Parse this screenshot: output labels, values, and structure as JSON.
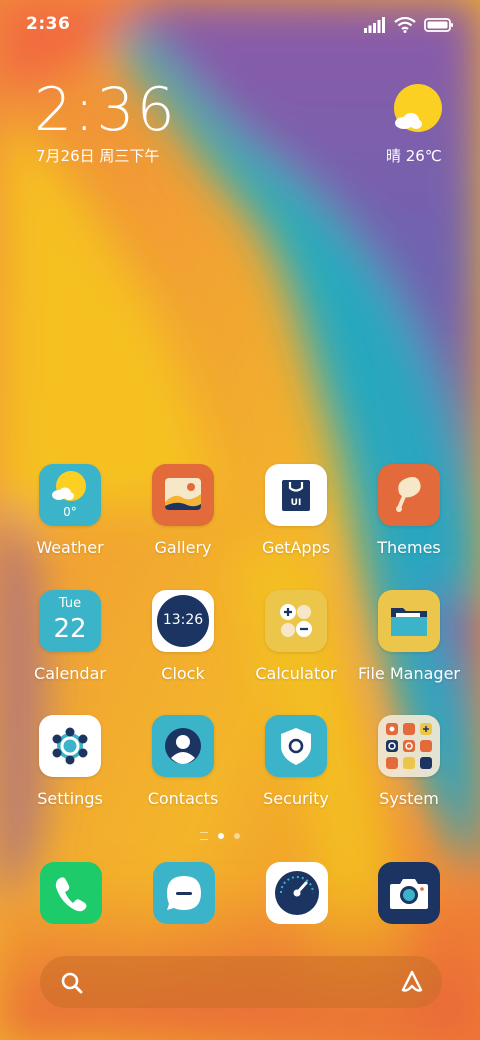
{
  "status_bar": {
    "time": "2:36"
  },
  "clock_widget": {
    "time": "2:36",
    "date": "7月26日 周三下午",
    "weather": "晴 26℃"
  },
  "apps": [
    {
      "name": "weather",
      "label": "Weather",
      "temp": "0°"
    },
    {
      "name": "gallery",
      "label": "Gallery"
    },
    {
      "name": "getapps",
      "label": "GetApps",
      "badge": "UI"
    },
    {
      "name": "themes",
      "label": "Themes"
    },
    {
      "name": "calendar",
      "label": "Calendar",
      "weekday": "Tue",
      "day": "22"
    },
    {
      "name": "clock",
      "label": "Clock",
      "time": "13:26"
    },
    {
      "name": "calculator",
      "label": "Calculator"
    },
    {
      "name": "file-manager",
      "label": "File Manager"
    },
    {
      "name": "settings",
      "label": "Settings"
    },
    {
      "name": "contacts",
      "label": "Contacts"
    },
    {
      "name": "security",
      "label": "Security"
    },
    {
      "name": "system",
      "label": "System"
    }
  ],
  "dock": [
    "phone-icon",
    "messages-icon",
    "browser-icon",
    "camera-icon"
  ],
  "pager": {
    "pages": 2,
    "active": 1
  },
  "colors": {
    "accent_blue": "#3bb3c9",
    "navy": "#1b3461",
    "orange": "#e36a3b",
    "yellow": "#f5c842"
  }
}
